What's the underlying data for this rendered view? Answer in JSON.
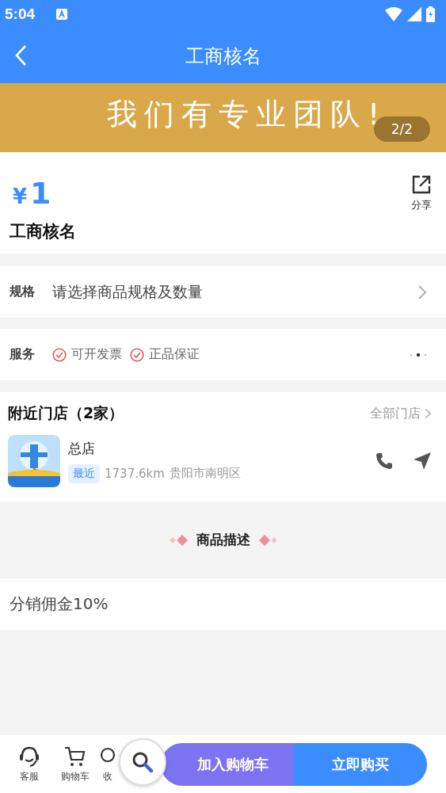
{
  "status_bar": {
    "time": "5:04"
  },
  "header": {
    "title": "工商核名"
  },
  "banner": {
    "text": "我们有专业团队!",
    "counter": "2/2"
  },
  "product": {
    "currency": "¥",
    "price": "1",
    "name": "工商核名",
    "share": "分享"
  },
  "spec": {
    "label": "规格",
    "value": "请选择商品规格及数量"
  },
  "service": {
    "label": "服务",
    "items": [
      "可开发票",
      "正品保证"
    ]
  },
  "stores": {
    "title": "附近门店（2家）",
    "all_link": "全部门店",
    "items": [
      {
        "name": "总店",
        "tag": "最近",
        "distance": "1737.6km",
        "area": "贵阳市南明区"
      }
    ]
  },
  "description": {
    "heading": "商品描述",
    "text": "分销佣金10%"
  },
  "bottom_bar": {
    "icons": [
      {
        "kind": "service",
        "label": "客服"
      },
      {
        "kind": "cart",
        "label": "购物车"
      },
      {
        "kind": "favorite",
        "label": "收"
      }
    ],
    "add_to_cart": "加入购物车",
    "buy_now": "立即购买"
  }
}
